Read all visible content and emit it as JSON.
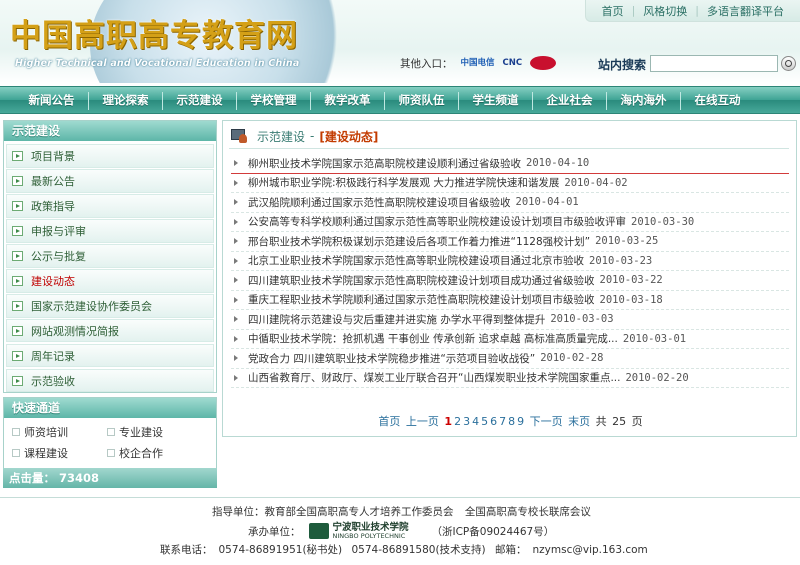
{
  "header": {
    "title": "中国高职高专教育网",
    "subtitle": "Higher Technical and Vocational Education in China",
    "top_links": [
      "首页",
      "风格切换",
      "多语言翻译平台"
    ],
    "other_entry_label": "其他入口：",
    "entry_logos": [
      "中国电信",
      "CNC",
      ""
    ],
    "search_label": "站内搜索",
    "search_value": ""
  },
  "nav": [
    "新闻公告",
    "理论探索",
    "示范建设",
    "学校管理",
    "教学改革",
    "师资队伍",
    "学生频道",
    "企业社会",
    "海内海外",
    "在线互动"
  ],
  "sidebar": {
    "menu_title": "示范建设",
    "items": [
      {
        "label": "项目背景",
        "active": false
      },
      {
        "label": "最新公告",
        "active": false
      },
      {
        "label": "政策指导",
        "active": false
      },
      {
        "label": "申报与评审",
        "active": false
      },
      {
        "label": "公示与批复",
        "active": false
      },
      {
        "label": "建设动态",
        "active": true
      },
      {
        "label": "国家示范建设协作委员会",
        "active": false
      },
      {
        "label": "网站观测情况简报",
        "active": false
      },
      {
        "label": "周年记录",
        "active": false
      },
      {
        "label": "示范验收",
        "active": false
      }
    ],
    "quick_title": "快速通道",
    "quick_items": [
      "师资培训",
      "专业建设",
      "课程建设",
      "校企合作"
    ],
    "visits": "点击量： 73408"
  },
  "main": {
    "breadcrumb_section": "示范建设",
    "breadcrumb_sep": "-",
    "breadcrumb_current": "[建设动态]",
    "articles": [
      {
        "title": "柳州职业技术学院国家示范高职院校建设顺利通过省级验收",
        "date": "2010-04-10"
      },
      {
        "title": "柳州城市职业学院:积极践行科学发展观 大力推进学院快速和谐发展",
        "date": "2010-04-02"
      },
      {
        "title": "武汉船院顺利通过国家示范性高职院校建设项目省级验收",
        "date": "2010-04-01"
      },
      {
        "title": "公安高等专科学校顺利通过国家示范性高等职业院校建设设计划项目市级验收评审",
        "date": "2010-03-30"
      },
      {
        "title": "邢台职业技术学院积极谋划示范建设后各项工作着力推进“1128强校计划”",
        "date": "2010-03-25"
      },
      {
        "title": "北京工业职业技术学院国家示范性高等职业院校建设项目通过北京市验收",
        "date": "2010-03-23"
      },
      {
        "title": "四川建筑职业技术学院国家示范性高职院校建设计划项目成功通过省级验收",
        "date": "2010-03-22"
      },
      {
        "title": "重庆工程职业技术学院顺利通过国家示范性高职院校建设计划项目市级验收",
        "date": "2010-03-18"
      },
      {
        "title": "四川建院将示范建设与灾后重建并进实施 办学水平得到整体提升",
        "date": "2010-03-03"
      },
      {
        "title": "中循职业技术学院：抢抓机遇 干事创业 传承创新 追求卓越 高标准高质量完成...",
        "date": "2010-03-01"
      },
      {
        "title": "党政合力 四川建筑职业技术学院稳步推进“示范项目验收战役”",
        "date": "2010-02-28"
      },
      {
        "title": "山西省教育厅、财政厅、煤炭工业厅联合召开“山西煤炭职业技术学院国家重点...",
        "date": "2010-02-20"
      }
    ],
    "pager": {
      "first": "首页",
      "prev": "上一页",
      "pages": [
        "1",
        "2",
        "3",
        "4",
        "5",
        "6",
        "7",
        "8",
        "9"
      ],
      "current_page": "1",
      "next": "下一页",
      "last": "末页",
      "total_prefix": "共",
      "total_pages": "25",
      "total_suffix": "页"
    }
  },
  "footer": {
    "guide_label": "指导单位：教育部全国高职高专人才培养工作委员会",
    "guide_label2": "全国高职高专校长联席会议",
    "host_label": "承办单位：",
    "host_logo_cn": "宁波职业技术学院",
    "host_logo_en": "NINGBO POLYTECHNIC",
    "icp": "（浙ICP备09024467号）",
    "contact_label": "联系电话：",
    "phone1": "0574-86891951(秘书处)",
    "phone2": "0574-86891580(技术支持)",
    "email_label": "邮箱：",
    "email": "nzymsc@vip.163.com"
  }
}
